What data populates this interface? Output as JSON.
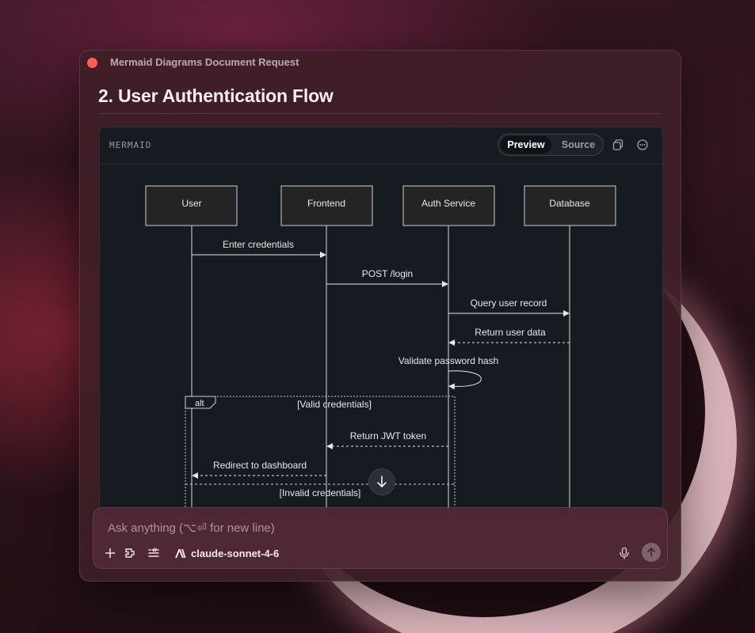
{
  "window": {
    "title": "Mermaid Diagrams Document Request"
  },
  "heading": "2. User Authentication Flow",
  "code_card": {
    "language": "MERMAID",
    "tabs": {
      "preview": "Preview",
      "source": "Source"
    },
    "active_tab": "Preview"
  },
  "diagram": {
    "participants": [
      "User",
      "Frontend",
      "Auth Service",
      "Database"
    ],
    "messages": [
      "Enter credentials",
      "POST /login",
      "Query user record",
      "Return user data",
      "Validate password hash",
      "Return JWT token",
      "Redirect to dashboard"
    ],
    "alt_block": {
      "label": "alt",
      "branches": [
        "[Valid credentials]",
        "[Invalid credentials]"
      ]
    }
  },
  "composer": {
    "placeholder": "Ask anything (⌥⏎ for new line)",
    "model": "claude-sonnet-4-6"
  },
  "colors": {
    "close": "#ff5f57",
    "diagram_bg": "#161b22",
    "participant_box": "#242424",
    "line": "#e6e6e6"
  },
  "icons": [
    "copy-icon",
    "more-icon",
    "arrow-down-icon",
    "plus-icon",
    "plugin-icon",
    "tools-icon",
    "anthropic-logo-icon",
    "microphone-icon",
    "arrow-up-icon"
  ]
}
